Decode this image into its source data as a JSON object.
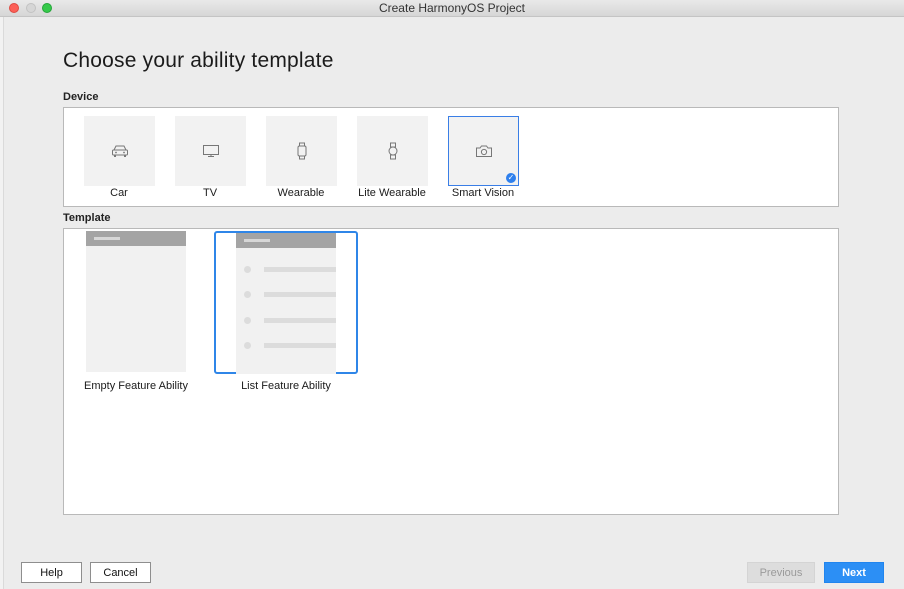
{
  "window": {
    "title": "Create HarmonyOS Project"
  },
  "page": {
    "heading": "Choose your ability template"
  },
  "device_section": {
    "label": "Device",
    "items": [
      {
        "label": "Car",
        "icon": "car-icon",
        "selected": false
      },
      {
        "label": "TV",
        "icon": "tv-icon",
        "selected": false
      },
      {
        "label": "Wearable",
        "icon": "watch-icon",
        "selected": false
      },
      {
        "label": "Lite Wearable",
        "icon": "watch-icon",
        "selected": false
      },
      {
        "label": "Smart Vision",
        "icon": "camera-icon",
        "selected": true
      }
    ]
  },
  "template_section": {
    "label": "Template",
    "items": [
      {
        "label": "Empty Feature Ability",
        "selected": false
      },
      {
        "label": "List Feature Ability",
        "selected": true
      }
    ]
  },
  "buttons": {
    "help": "Help",
    "cancel": "Cancel",
    "previous": "Previous",
    "next": "Next"
  },
  "colors": {
    "accent": "#2c8ff5",
    "selection_border": "#2f86e8"
  }
}
